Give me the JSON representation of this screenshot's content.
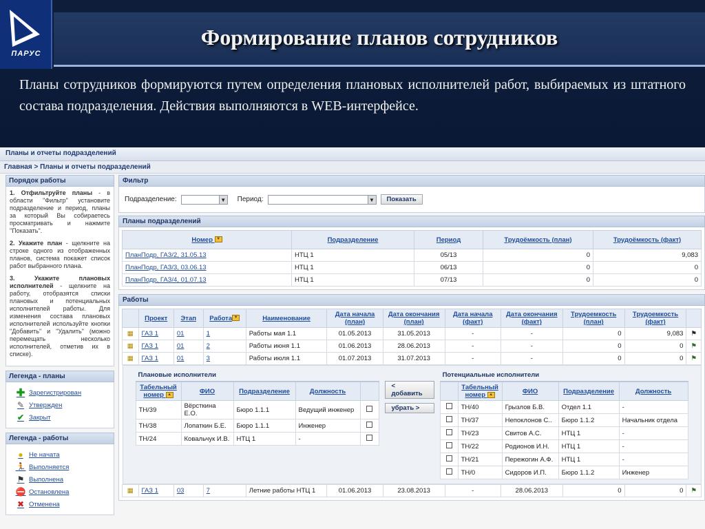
{
  "slide": {
    "logo_text": "ПАРУС",
    "title": "Формирование планов сотрудников",
    "intro": "Планы сотрудников формируются путем определения плановых исполнителей работ, выбираемых из штатного состава подразделения. Действия выполняются в WEB-интерфейсе."
  },
  "app": {
    "header": "Планы и отчеты подразделений",
    "breadcrumb": {
      "home": "Главная",
      "sep": ">",
      "current": "Планы и отчеты подразделений"
    }
  },
  "left": {
    "help_title": "Порядок работы",
    "steps": [
      {
        "bold": "1. Отфильтруйте планы",
        "text": " - в области \"Фильтр\" установите подразделение и период, планы за который Вы собираетесь просматривать и нажмите \"Показать\"."
      },
      {
        "bold": "2. Укажите план",
        "text": " - щелкните на строке одного из отображенных планов, система покажет список работ выбранного плана."
      },
      {
        "bold": "3. Укажите плановых исполнителей",
        "text": " - щелкните на работу, отобразятся списки плановых и потенциальных исполнителей работы. Для изменения состава плановых исполнителей используйте кнопки \"Добавить\" и \"Удалить\" (можно перемещать несколько исполнителей, отметив их в списке)."
      }
    ],
    "legend_plans_title": "Легенда - планы",
    "legend_plans": [
      {
        "label": "Зарегистрирован",
        "icon": "plus-icon"
      },
      {
        "label": "Утвержден",
        "icon": "edit-icon"
      },
      {
        "label": "Закрыт",
        "icon": "check-icon"
      }
    ],
    "legend_works_title": "Легенда - работы",
    "legend_works": [
      {
        "label": "Не начата",
        "icon": "bulb-icon"
      },
      {
        "label": "Выполняется",
        "icon": "running-icon"
      },
      {
        "label": "Выполнена",
        "icon": "finish-flag-icon"
      },
      {
        "label": "Остановлена",
        "icon": "stop-icon"
      },
      {
        "label": "Отменена",
        "icon": "cancel-icon"
      }
    ]
  },
  "filter": {
    "title": "Фильтр",
    "division_label": "Подразделение:",
    "division_value": "",
    "period_label": "Период:",
    "period_value": "",
    "show_button": "Показать"
  },
  "plans": {
    "title": "Планы подразделений",
    "columns": [
      "Номер",
      "Подразделение",
      "Период",
      "Трудоёмкость (план)",
      "Трудоёмкость (факт)"
    ],
    "rows": [
      [
        "ПланПодр, ГАЗ/2, 31.05.13",
        "НТЦ 1",
        "05/13",
        "0",
        "9,083"
      ],
      [
        "ПланПодр, ГАЗ/3, 03.06.13",
        "НТЦ 1",
        "06/13",
        "0",
        "0"
      ],
      [
        "ПланПодр, ГАЗ/4, 01.07.13",
        "НТЦ 1",
        "07/13",
        "0",
        "0"
      ]
    ]
  },
  "works": {
    "title": "Работы",
    "columns": [
      "Проект",
      "Этап",
      "Работа",
      "Наименование",
      "Дата начала (план)",
      "Дата окончания (план)",
      "Дата начала (факт)",
      "Дата окончания (факт)",
      "Трудоемкость (план)",
      "Трудоемкость (факт)"
    ],
    "rows": [
      [
        "ГАЗ 1",
        "01",
        "1",
        "Работы мая 1.1",
        "01.05.2013",
        "31.05.2013",
        "-",
        "-",
        "0",
        "9,083"
      ],
      [
        "ГАЗ 1",
        "01",
        "2",
        "Работы июня 1.1",
        "01.06.2013",
        "28.06.2013",
        "-",
        "-",
        "0",
        "0"
      ],
      [
        "ГАЗ 1",
        "01",
        "3",
        "Работы июля 1.1",
        "01.07.2013",
        "31.07.2013",
        "-",
        "-",
        "0",
        "0"
      ]
    ],
    "last_row": [
      "ГАЗ 1",
      "03",
      "7",
      "Летние работы НТЦ 1",
      "01.06.2013",
      "23.08.2013",
      "-",
      "28.06.2013",
      "0",
      "0"
    ]
  },
  "planned": {
    "title": "Плановые исполнители",
    "columns": [
      "Табельный номер",
      "ФИО",
      "Подразделение",
      "Должность"
    ],
    "rows": [
      [
        "ТН/39",
        "Вёрсткина Е.О.",
        "Бюро 1.1.1",
        "Ведущий инженер"
      ],
      [
        "ТН/38",
        "Лопаткин Б.Е.",
        "Бюро 1.1.1",
        "Инженер"
      ],
      [
        "ТН/24",
        "Ковальчук И.В.",
        "НТЦ 1",
        "-"
      ]
    ]
  },
  "buttons": {
    "add": "< добавить",
    "remove": "убрать >"
  },
  "potential": {
    "title": "Потенциальные исполнители",
    "columns": [
      "Табельный номер",
      "ФИО",
      "Подразделение",
      "Должность"
    ],
    "rows": [
      [
        "ТН/40",
        "Грызлов Б.В.",
        "Отдел 1.1",
        "-"
      ],
      [
        "ТН/37",
        "Непоклонов С..",
        "Бюро 1.1.2",
        "Начальник отдела"
      ],
      [
        "ТН/23",
        "Свитов А.С.",
        "НТЦ 1",
        "-"
      ],
      [
        "ТН/22",
        "Родионов И.Н.",
        "НТЦ 1",
        "-"
      ],
      [
        "ТН/21",
        "Пережогин А.Ф.",
        "НТЦ 1",
        "-"
      ],
      [
        "ТН/0",
        "Сидоров И.П.",
        "Бюро 1.1.2",
        "Инженер"
      ]
    ]
  }
}
